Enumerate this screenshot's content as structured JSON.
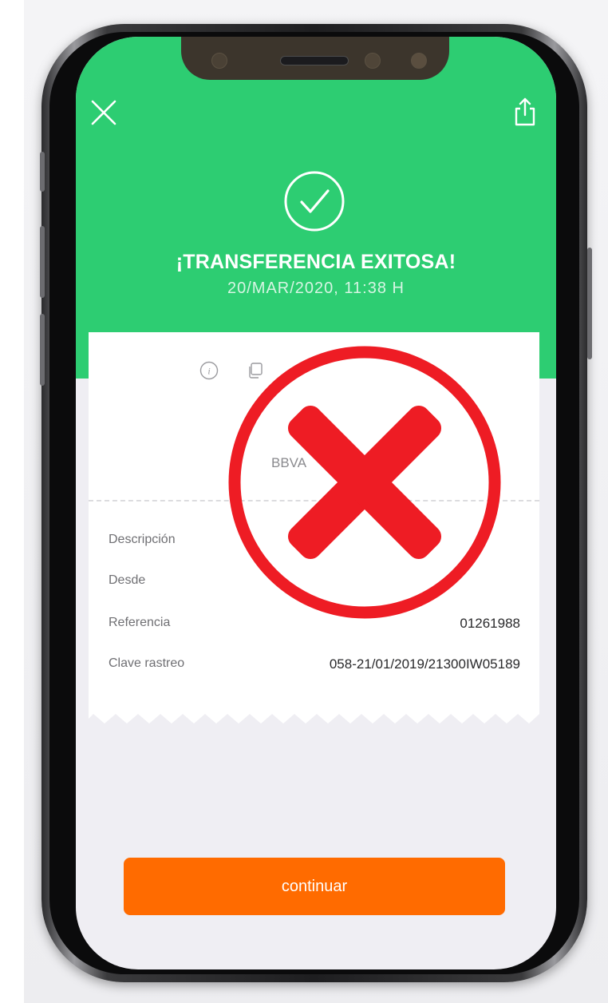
{
  "header": {
    "title": "¡TRANSFERENCIA EXITOSA!",
    "datetime": "20/MAR/2020, 11:38 H",
    "bg_color": "#2dcd72"
  },
  "toolbar": {
    "close_icon": "close-icon",
    "share_icon": "share-icon"
  },
  "receipt": {
    "bank": "BBVA",
    "rows": [
      {
        "label": "Descripción",
        "value": ""
      },
      {
        "label": "Desde",
        "value": ""
      },
      {
        "label": "Referencia",
        "value": "01261988"
      },
      {
        "label": "Clave rastreo",
        "value": "058-21/01/2019/21300IW05189"
      }
    ]
  },
  "overlay": {
    "icon": "red-x-mark-icon",
    "color": "#ee1c24"
  },
  "footer": {
    "continue_label": "continuar",
    "button_color": "#ff6b00"
  }
}
